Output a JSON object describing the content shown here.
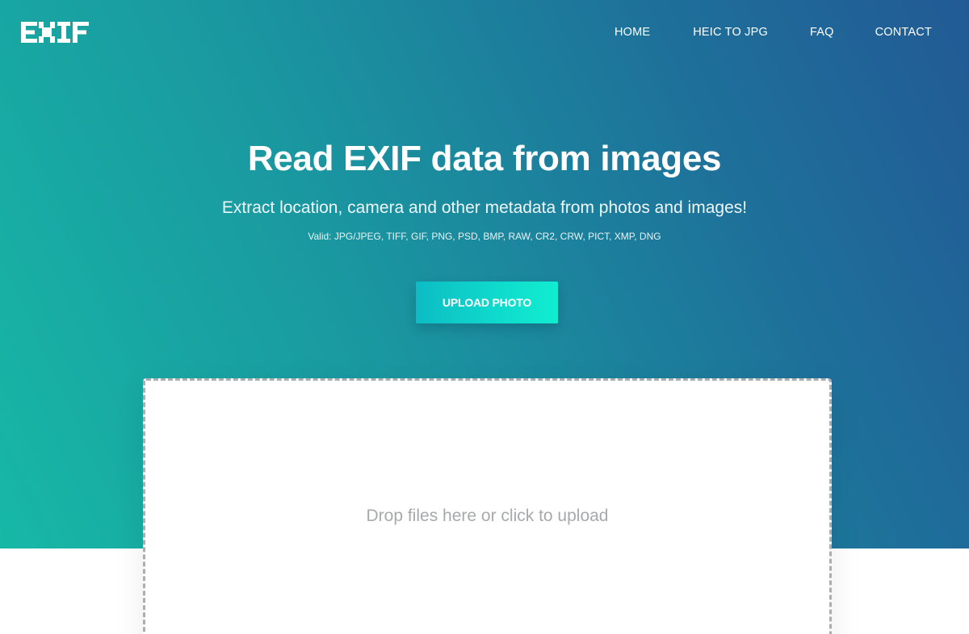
{
  "header": {
    "logo_text": "EXIF",
    "nav": [
      {
        "label": "HOME"
      },
      {
        "label": "HEIC TO JPG"
      },
      {
        "label": "FAQ"
      },
      {
        "label": "CONTACT"
      }
    ]
  },
  "hero": {
    "title": "Read EXIF data from images",
    "subtitle": "Extract location, camera and other metadata from photos and images!",
    "valid_formats": "Valid: JPG/JPEG, TIFF, GIF, PNG, PSD, BMP, RAW, CR2, CRW, PICT, XMP, DNG",
    "upload_button": "UPLOAD PHOTO"
  },
  "dropzone": {
    "text": "Drop files here or click to upload"
  },
  "colors": {
    "gradient_start": "#17b8a6",
    "gradient_end": "#225a95",
    "button_accent": "#10edd0",
    "dropzone_border": "#a9aeb2",
    "dropzone_text": "#a7a9ab"
  },
  "icons": {
    "logo": "exif-logo"
  }
}
